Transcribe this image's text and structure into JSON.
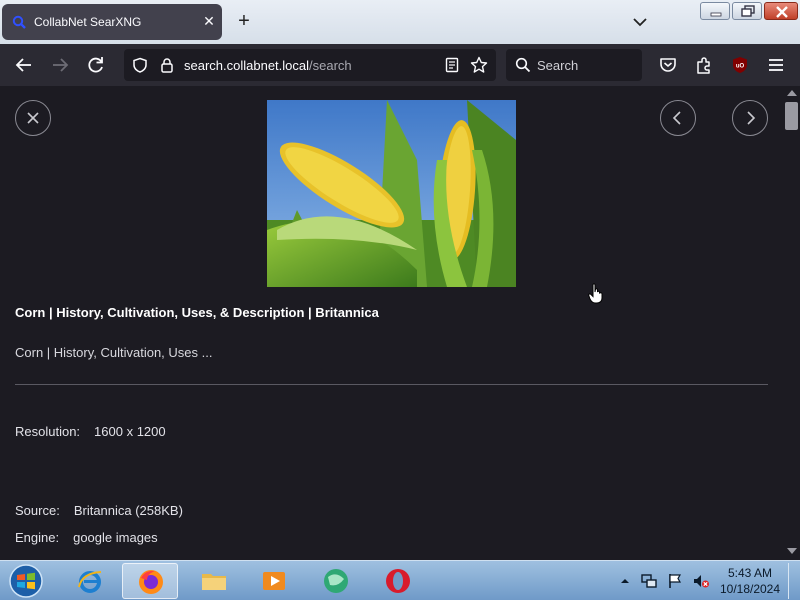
{
  "browser": {
    "tab_title": "CollabNet SearXNG",
    "url_host": "search.collabnet.local",
    "url_path": "/search",
    "search_placeholder": "Search"
  },
  "result": {
    "title": "Corn | History, Cultivation, Uses, & Description | Britannica",
    "snippet": "Corn | History, Cultivation, Uses ...",
    "resolution_label": "Resolution:",
    "resolution_value": "1600 x 1200",
    "source_label": "Source:",
    "source_value": "Britannica (258KB)",
    "engine_label": "Engine:",
    "engine_value": "google images"
  },
  "taskbar": {
    "time": "5:43 AM",
    "date": "10/18/2024"
  },
  "colors": {
    "page_bg": "#1c1b22",
    "toolbar_bg": "#2b2a33",
    "tab_bg": "#42414d",
    "searxng_accent": "#3050ff"
  }
}
